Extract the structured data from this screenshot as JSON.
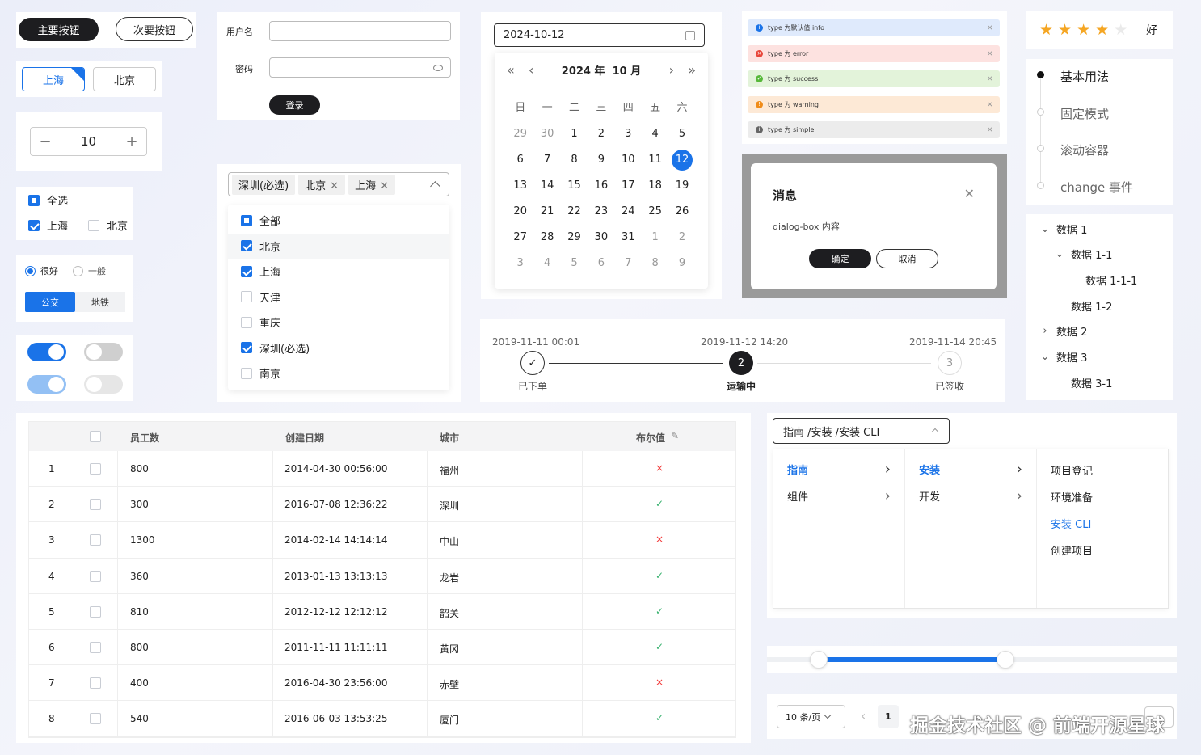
{
  "buttons": {
    "primary": "主要按钮",
    "secondary": "次要按钮"
  },
  "city_toggle": [
    "上海",
    "北京"
  ],
  "stepper": {
    "minus": "−",
    "value": "10",
    "plus": "+"
  },
  "checkgroup": {
    "all": "全选",
    "a": "上海",
    "b": "北京"
  },
  "radio": {
    "good": "很好",
    "normal": "一般"
  },
  "transport": [
    "公交",
    "地铁"
  ],
  "login": {
    "user_label": "用户名",
    "pwd_label": "密码",
    "user_value": "",
    "pwd_value": "",
    "submit": "登录"
  },
  "multiselect": {
    "tags": [
      "深圳(必选)",
      "北京",
      "上海"
    ],
    "options": [
      {
        "label": "全部",
        "checked": "ind"
      },
      {
        "label": "北京",
        "checked": "on"
      },
      {
        "label": "上海",
        "checked": "on"
      },
      {
        "label": "天津",
        "checked": "off"
      },
      {
        "label": "重庆",
        "checked": "off"
      },
      {
        "label": "深圳(必选)",
        "checked": "on"
      },
      {
        "label": "南京",
        "checked": "off"
      }
    ]
  },
  "datepicker": {
    "value": "2024-10-12",
    "year": "2024 年",
    "month": "10 月",
    "weekdays": [
      "日",
      "一",
      "二",
      "三",
      "四",
      "五",
      "六"
    ],
    "days": [
      "29",
      "30",
      "1",
      "2",
      "3",
      "4",
      "5",
      "6",
      "7",
      "8",
      "9",
      "10",
      "11",
      "12",
      "13",
      "14",
      "15",
      "16",
      "17",
      "18",
      "19",
      "20",
      "21",
      "22",
      "23",
      "24",
      "25",
      "26",
      "27",
      "28",
      "29",
      "30",
      "31",
      "1",
      "2",
      "3",
      "4",
      "5",
      "6",
      "7",
      "8",
      "9"
    ],
    "selected": "12"
  },
  "alerts": [
    {
      "text": "type 为默认值 info",
      "color": "#1a73e8",
      "bg": "#dfeafc",
      "icon": "i"
    },
    {
      "text": "type 为 error",
      "color": "#e8463a",
      "bg": "#fde2e0",
      "icon": "×"
    },
    {
      "text": "type 为 success",
      "color": "#57b83a",
      "bg": "#e3f3da",
      "icon": "✓"
    },
    {
      "text": "type 为 warning",
      "color": "#f08c1a",
      "bg": "#fde9d6",
      "icon": "!"
    },
    {
      "text": "type 为 simple",
      "color": "#666",
      "bg": "#ececec",
      "icon": "i"
    }
  ],
  "alert_close": "×",
  "dialog": {
    "title": "消息",
    "content": "dialog-box 内容",
    "ok": "确定",
    "cancel": "取消"
  },
  "rating": {
    "label": "好",
    "stars": 4
  },
  "timeline": [
    "基本用法",
    "固定模式",
    "滚动容器",
    "change 事件"
  ],
  "tree": [
    {
      "label": "数据 1",
      "level": 0,
      "arrow": "⌄"
    },
    {
      "label": "数据 1-1",
      "level": 1,
      "arrow": "⌄"
    },
    {
      "label": "数据 1-1-1",
      "level": 2,
      "arrow": ""
    },
    {
      "label": "数据 1-2",
      "level": 1,
      "arrow": ""
    },
    {
      "label": "数据 2",
      "level": 0,
      "arrow": "›"
    },
    {
      "label": "数据 3",
      "level": 0,
      "arrow": "⌄"
    },
    {
      "label": "数据 3-1",
      "level": 1,
      "arrow": ""
    }
  ],
  "steps": [
    {
      "time": "2019-11-11 00:01",
      "label": "已下单",
      "mark": "✓"
    },
    {
      "time": "2019-11-12 14:20",
      "label": "运输中",
      "mark": "2"
    },
    {
      "time": "2019-11-14 20:45",
      "label": "已签收",
      "mark": "3"
    }
  ],
  "table": {
    "headers": [
      "员工数",
      "创建日期",
      "城市",
      "布尔值"
    ],
    "rows": [
      [
        "1",
        "800",
        "2014-04-30 00:56:00",
        "福州",
        "×"
      ],
      [
        "2",
        "300",
        "2016-07-08 12:36:22",
        "深圳",
        "✓"
      ],
      [
        "3",
        "1300",
        "2014-02-14 14:14:14",
        "中山",
        "×"
      ],
      [
        "4",
        "360",
        "2013-01-13 13:13:13",
        "龙岩",
        "✓"
      ],
      [
        "5",
        "810",
        "2012-12-12 12:12:12",
        "韶关",
        "✓"
      ],
      [
        "6",
        "800",
        "2011-11-11 11:11:11",
        "黄冈",
        "✓"
      ],
      [
        "7",
        "400",
        "2016-04-30 23:56:00",
        "赤壁",
        "×"
      ],
      [
        "8",
        "540",
        "2016-06-03 13:53:25",
        "厦门",
        "✓"
      ]
    ]
  },
  "cascader": {
    "value": "指南 /安装 /安装 CLI",
    "col1": [
      "指南",
      "组件"
    ],
    "col2": [
      "安装",
      "开发"
    ],
    "col3": [
      "项目登记",
      "环境准备",
      "安装 CLI",
      "创建项目"
    ]
  },
  "slider": {
    "min": 0.02,
    "max": 0.56
  },
  "pagination": {
    "size": "10 条/页",
    "page": "1"
  },
  "watermark": "掘金技术社区 @ 前端开源星球"
}
